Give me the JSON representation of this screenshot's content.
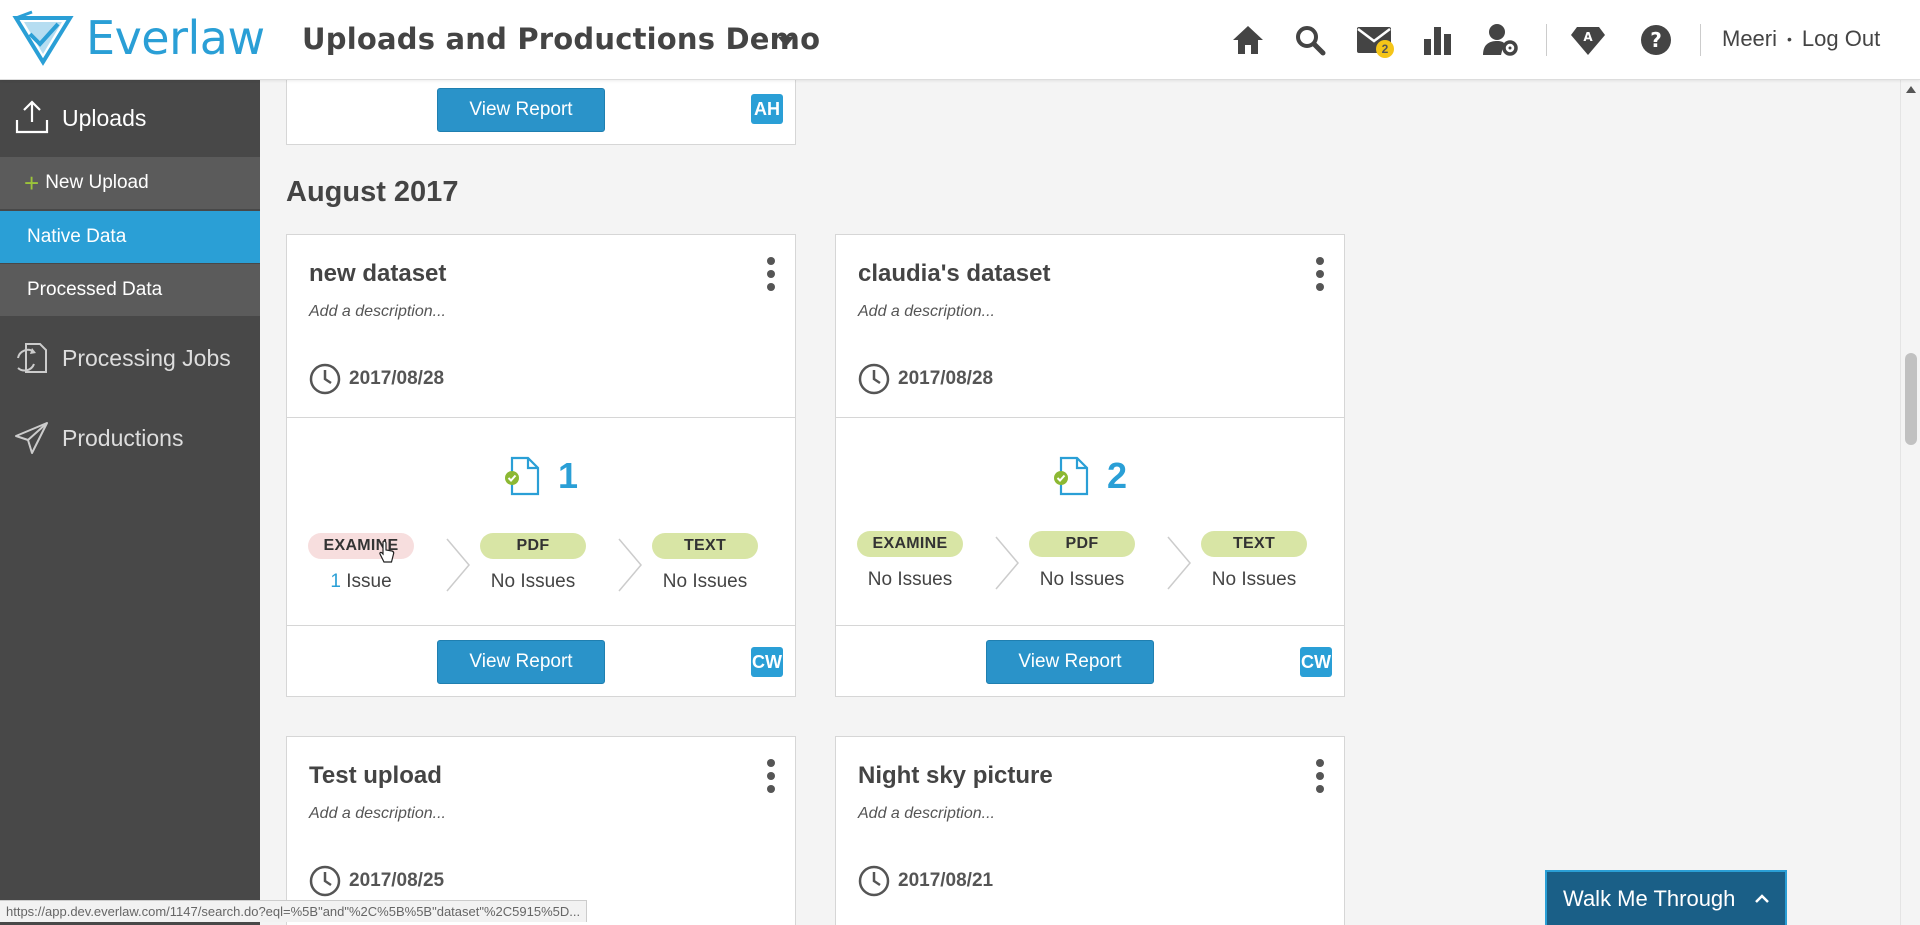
{
  "header": {
    "logo_text": "Everlaw",
    "project_title": "Uploads and Productions Demo",
    "mail_badge": "2",
    "user_name": "Meeri",
    "separator": "•",
    "logout_label": "Log Out",
    "brand_color": "#2a9fd6"
  },
  "sidebar": {
    "uploads": "Uploads",
    "new_upload": "New Upload",
    "native_data": "Native Data",
    "processed_data": "Processed Data",
    "processing_jobs": "Processing Jobs",
    "productions": "Productions"
  },
  "top_card": {
    "view_report": "View Report",
    "initials": "AH"
  },
  "month_heading": "August 2017",
  "cards": [
    {
      "title": "new dataset",
      "description": "Add a description...",
      "date": "2017/08/28",
      "doc_count": "1",
      "stages": [
        {
          "label": "EXAMINE",
          "status_num": "1",
          "status_text": "Issue",
          "warn": true
        },
        {
          "label": "PDF",
          "status_text": "No Issues"
        },
        {
          "label": "TEXT",
          "status_text": "No Issues"
        }
      ],
      "view_report": "View Report",
      "initials": "CW"
    },
    {
      "title": "claudia's dataset",
      "description": "Add a description...",
      "date": "2017/08/28",
      "doc_count": "2",
      "stages": [
        {
          "label": "EXAMINE",
          "status_text": "No Issues"
        },
        {
          "label": "PDF",
          "status_text": "No Issues"
        },
        {
          "label": "TEXT",
          "status_text": "No Issues"
        }
      ],
      "view_report": "View Report",
      "initials": "CW"
    },
    {
      "title": "Test upload",
      "description": "Add a description...",
      "date": "2017/08/25"
    },
    {
      "title": "Night sky picture",
      "description": "Add a description...",
      "date": "2017/08/21"
    }
  ],
  "walkme": "Walk Me Through",
  "status_url": "https://app.dev.everlaw.com/1147/search.do?eql=%5B\"and\"%2C%5B%5B\"dataset\"%2C5915%5D..."
}
